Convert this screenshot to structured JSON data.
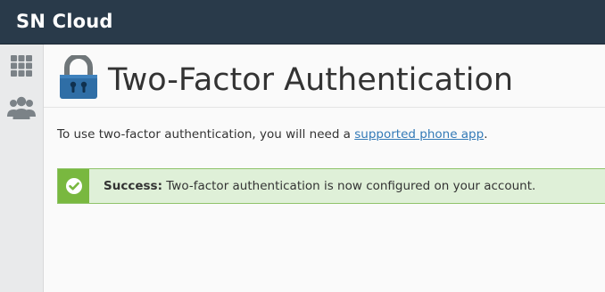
{
  "app": {
    "brand": "SN Cloud"
  },
  "sidebar": {
    "items": [
      {
        "icon": "grid-icon",
        "label": ""
      },
      {
        "icon": "users-icon",
        "label": ""
      }
    ]
  },
  "page": {
    "title": "Two-Factor Authentication",
    "intro_prefix": "To use two-factor authentication, you will need a ",
    "intro_link": "supported phone app",
    "intro_suffix": "."
  },
  "alert": {
    "label": "Success:",
    "message": " Two-factor authentication is now configured on your account.",
    "status": "success"
  },
  "colors": {
    "topbar": "#293a4a",
    "accent_link": "#337ab7",
    "success_bg": "#dff0d8",
    "success_icon_bg": "#79b83f",
    "lock_body": "#2f6ea6",
    "lock_shackle": "#6f7679"
  }
}
